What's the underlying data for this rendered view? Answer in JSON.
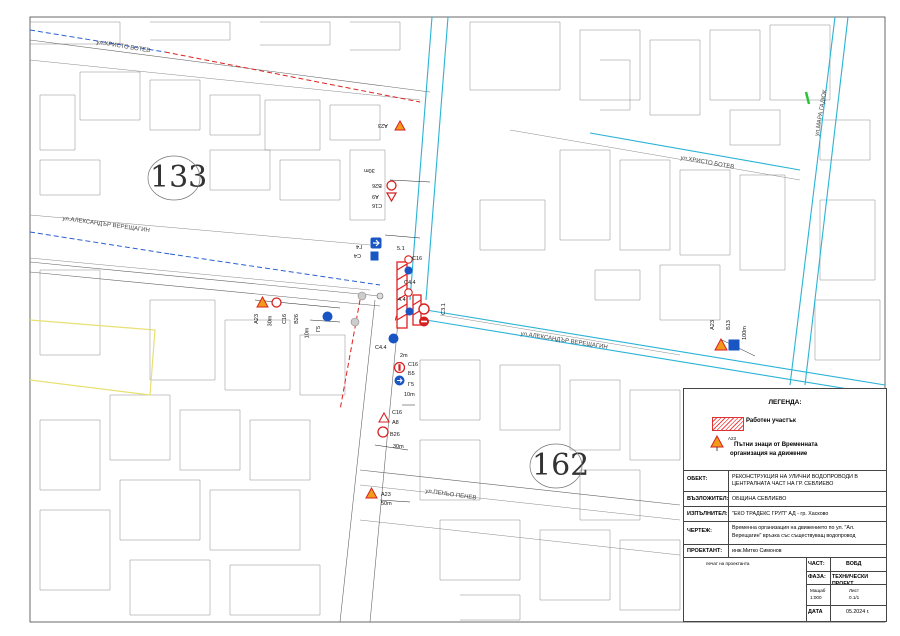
{
  "map": {
    "streets": {
      "hristo_botev_west": "ул.ХРИСТО  БОТЕВ",
      "hristo_botev_east": "ул.ХРИСТО  БОТЕВ",
      "aleksandar_vereshtagin_west": "ул.АЛЕКСАНДЪР ВЕРЕЩАГИН",
      "aleksandar_vereshtagin_east": "ул.АЛЕКСАНДЪР ВЕРЕЩАГИН",
      "marin_gadjuk": "ул.МАРА  ГАДЮК",
      "penyo_penev": "ул.ПЕНЬО  ПЕНЕВ"
    },
    "blocks": {
      "block_133": "133",
      "block_162": "162"
    },
    "signs": {
      "a23_top": "A23",
      "c16_b26": "C16",
      "b26_top": "B26",
      "dist_30m_top": "30m",
      "a23_a": "A9",
      "g4": "Г4",
      "c4_top": "C4",
      "c4_4": "4.4",
      "dist_5": "5.1",
      "c16_mid": "C16",
      "c4_mid": "C4.4",
      "g5_mid": "Г5",
      "c4_1": "C4.4",
      "c16_west": "C16",
      "b26_west": "B26",
      "a23_west": "A23",
      "dist_30m_west": "30m",
      "g5_west": "Г5",
      "dist_10m": "10m",
      "c16_south": "C16",
      "b5_south": "Б5",
      "g5_south": "Г5",
      "dist_10m_south": "10m",
      "c16_s2": "C16",
      "a8_s": "A8",
      "b26_s": "B26",
      "dist_30m_s": "30m",
      "a23_s": "A23",
      "dist_50m_s": "50m",
      "a23_east": "A23",
      "b13_east": "Б13",
      "dist_100m": "100m",
      "c3_1": "C3.1",
      "dist_2m": "2m"
    }
  },
  "legend": {
    "title": "ЛЕГЕНДА:",
    "work_area": "Работен участък",
    "sign_code": "A23",
    "temp_signs_line1": "Пътни знаци от Временната",
    "temp_signs_line2": "организация на движение"
  },
  "title_block": {
    "object_label": "ОБЕКТ:",
    "object_value_1": "РЕКОНСТРУКЦИЯ НА УЛИЧНИ ВОДОПРОВОДИ В",
    "object_value_2": "ЦЕНТРАЛНАТА ЧАСТ НА ГР. СЕВЛИЕВО",
    "client_label": "ВЪЗЛОЖИТЕЛ:",
    "client_value": "ОБЩИНА СЕВЛИЕВО",
    "contractor_label": "ИЗПЪЛНИТЕЛ:",
    "contractor_value": "\"ЕКО ТРАДЕКС ГРУП\" АД - гр. Хасково",
    "drawing_label": "ЧЕРТЕЖ:",
    "drawing_value_1": "Временна организация на движението по ул. \"Ал.",
    "drawing_value_2": "Верещагин\" връзка със съществуващ водопровод",
    "designer_label": "ПРОЕКТАНТ:",
    "designer_value": "инж.Митко Симонов",
    "stamp_label": "печат на проектанта",
    "part_label": "ЧАСТ:",
    "part_value": "ВОБД",
    "phase_label": "ФАЗА:",
    "phase_value": "ТЕХНИЧЕСКИ ПРОЕКТ",
    "scale_label": "Мащаб",
    "scale_value": "1:000",
    "sheet_label": "Лист",
    "sheet_value": "0.1/1",
    "date_label": "ДАТА",
    "date_value": "05.2024 г."
  },
  "colors": {
    "street_line": "#2ab3d6",
    "work_zone": "#e02020",
    "dashed_blue": "#2a5fd0",
    "sign_red": "#d62020",
    "sign_orange": "#f29a1a",
    "sign_blue": "#1a55c4",
    "building_line": "#7a7a7a",
    "plot_yellow": "#e8e070"
  }
}
